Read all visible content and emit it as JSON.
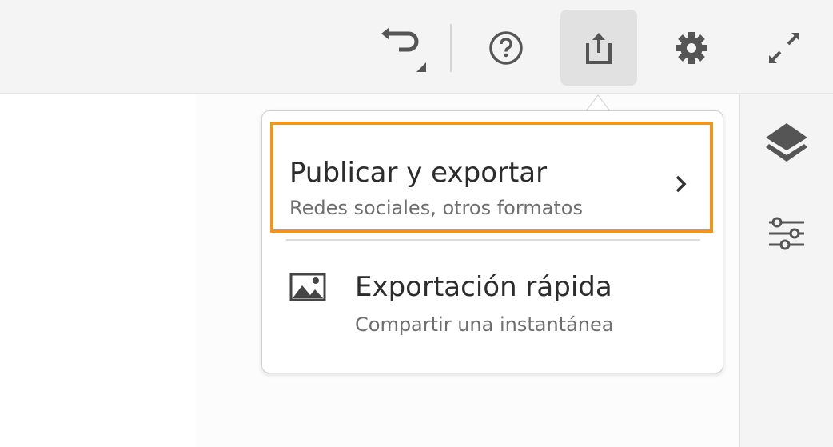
{
  "toolbar": {
    "buttons": [
      "undo-icon",
      "help-icon",
      "share-icon",
      "gear-icon",
      "expand-icon"
    ],
    "active": "share"
  },
  "menu": {
    "items": [
      {
        "title": "Publicar y exportar",
        "subtitle": "Redes sociales, otros formatos",
        "highlighted": true,
        "has_submenu": true
      },
      {
        "title": "Exportación rápida",
        "subtitle": "Compartir una instantánea",
        "icon": "image-icon"
      }
    ],
    "highlight_color": "#f0961e"
  },
  "right_panel": {
    "icons": [
      "layers-icon",
      "sliders-icon"
    ]
  }
}
